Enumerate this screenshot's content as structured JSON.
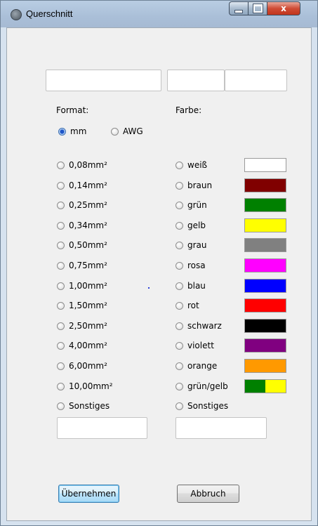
{
  "window": {
    "title": "Querschnitt"
  },
  "controls": {
    "close_glyph": "x"
  },
  "labels": {
    "format": "Format:",
    "farbe": "Farbe:"
  },
  "format_options": [
    {
      "label": "mm",
      "selected": true
    },
    {
      "label": "AWG",
      "selected": false
    }
  ],
  "cross_sections": [
    "0,08mm²",
    "0,14mm²",
    "0,25mm²",
    "0,34mm²",
    "0,50mm²",
    "0,75mm²",
    "1,00mm²",
    "1,50mm²",
    "2,50mm²",
    "4,00mm²",
    "6,00mm²",
    "10,00mm²",
    "Sonstiges"
  ],
  "colors": [
    {
      "label": "weiß",
      "hex": "#ffffff"
    },
    {
      "label": "braun",
      "hex": "#800000"
    },
    {
      "label": "grün",
      "hex": "#008000"
    },
    {
      "label": "gelb",
      "hex": "#ffff00"
    },
    {
      "label": "grau",
      "hex": "#808080"
    },
    {
      "label": "rosa",
      "hex": "#ff00ff"
    },
    {
      "label": "blau",
      "hex": "#0000ff"
    },
    {
      "label": "rot",
      "hex": "#ff0000"
    },
    {
      "label": "schwarz",
      "hex": "#000000"
    },
    {
      "label": "violett",
      "hex": "#800080"
    },
    {
      "label": "orange",
      "hex": "#ff9900"
    },
    {
      "label": "grün/gelb",
      "hex": "#008000",
      "hex2": "#ffff00"
    },
    {
      "label": "Sonstiges"
    }
  ],
  "buttons": {
    "apply": "Übernehmen",
    "cancel": "Abbruch"
  }
}
